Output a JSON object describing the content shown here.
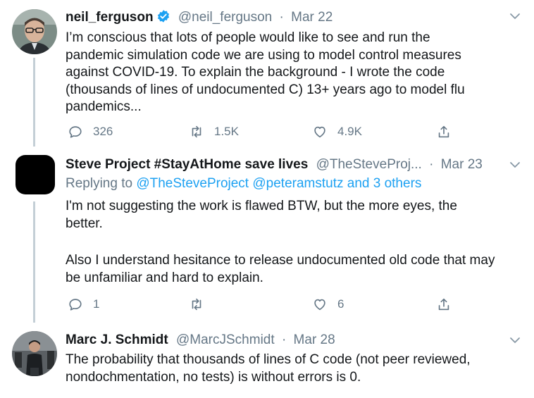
{
  "tweets": [
    {
      "name": "neil_ferguson",
      "handle": "@neil_ferguson",
      "separator": "·",
      "date": "Mar 22",
      "verified": true,
      "lines": [
        "I’m conscious that lots of people would like to see and run the",
        "pandemic simulation code we are using to model control measures",
        "against COVID-19.  To explain the background - I wrote the code",
        "(thousands of lines of undocumented C) 13+ years ago to model flu",
        "pandemics..."
      ],
      "replies": "326",
      "retweets": "1.5K",
      "likes": "4.9K"
    },
    {
      "name": "Steve Project #StayAtHome save lives",
      "handle": "@TheSteveProj...",
      "separator": "·",
      "date": "Mar 23",
      "replying_prefix": "Replying to",
      "replying_to": "@TheSteveProject @peteramstutz and 3 others",
      "lines": [
        "I'm not suggesting the work is flawed BTW, but the more eyes, the",
        "better.",
        "",
        "Also I understand hesitance to release undocumented old code that may",
        "be unfamiliar and hard to explain."
      ],
      "replies": "1",
      "retweets": "",
      "likes": "6"
    },
    {
      "name": "Marc J. Schmidt",
      "handle": "@MarcJSchmidt",
      "separator": "·",
      "date": "Mar 28",
      "lines": [
        "The probability that thousands of lines of C code (not peer reviewed,",
        "nondochmentation, no tests) is without errors is 0."
      ]
    }
  ],
  "icons": {
    "reply": "reply-icon",
    "retweet": "retweet-icon",
    "like": "heart-icon",
    "share": "share-icon",
    "more": "chevron-down-icon",
    "verified": "verified-badge-icon"
  },
  "colors": {
    "text": "#14171a",
    "muted": "#657786",
    "link": "#1da1f2",
    "thread_line": "#c4cfd6"
  }
}
